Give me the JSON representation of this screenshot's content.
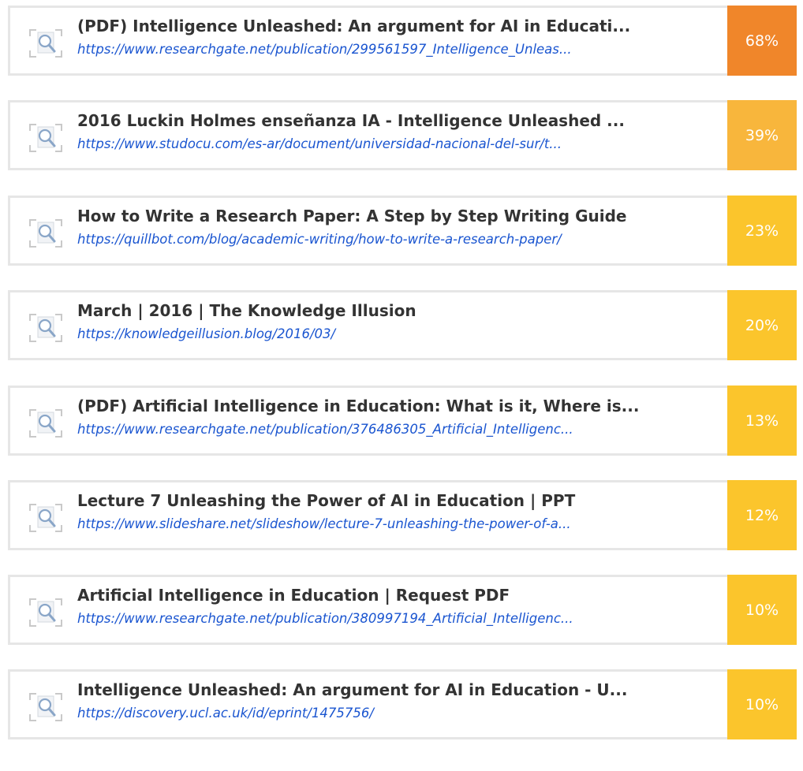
{
  "results": [
    {
      "title": "(PDF) Intelligence Unleashed: An argument for AI in Educati...",
      "url": "https://www.researchgate.net/publication/299561597_Intelligence_Unleas...",
      "percent": "68%",
      "color": "#f0862a"
    },
    {
      "title": "2016 Luckin Holmes enseñanza IA - Intelligence Unleashed ...",
      "url": "https://www.studocu.com/es-ar/document/universidad-nacional-del-sur/t...",
      "percent": "39%",
      "color": "#f8b63c"
    },
    {
      "title": "How to Write a Research Paper: A Step by Step Writing Guide",
      "url": "https://quillbot.com/blog/academic-writing/how-to-write-a-research-paper/",
      "percent": "23%",
      "color": "#fbc52c"
    },
    {
      "title": "March | 2016 | The Knowledge Illusion",
      "url": "https://knowledgeillusion.blog/2016/03/",
      "percent": "20%",
      "color": "#fbc52c"
    },
    {
      "title": "(PDF) Artificial Intelligence in Education: What is it, Where is...",
      "url": "https://www.researchgate.net/publication/376486305_Artificial_Intelligenc...",
      "percent": "13%",
      "color": "#fbc52c"
    },
    {
      "title": "Lecture 7 Unleashing the Power of AI in Education | PPT",
      "url": "https://www.slideshare.net/slideshow/lecture-7-unleashing-the-power-of-a...",
      "percent": "12%",
      "color": "#fbc52c"
    },
    {
      "title": "Artificial Intelligence in Education | Request PDF",
      "url": "https://www.researchgate.net/publication/380997194_Artificial_Intelligenc...",
      "percent": "10%",
      "color": "#fbc52c"
    },
    {
      "title": "Intelligence Unleashed: An argument for AI in Education - U...",
      "url": "https://discovery.ucl.ac.uk/id/eprint/1475756/",
      "percent": "10%",
      "color": "#fbc52c"
    }
  ],
  "icon": "magnifier-document-icon"
}
